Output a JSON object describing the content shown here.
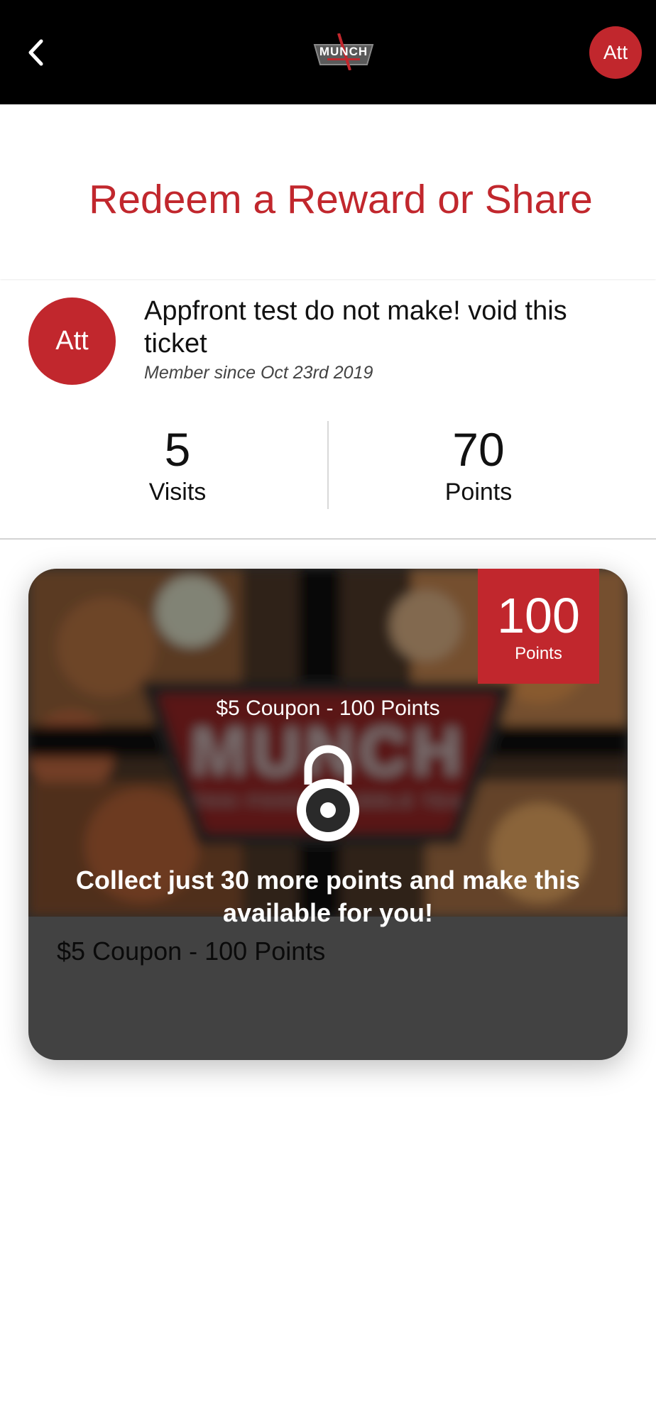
{
  "header": {
    "logo_text": "MUNCH",
    "avatar_initials": "Att"
  },
  "page": {
    "title": "Redeem a Reward or Share"
  },
  "profile": {
    "avatar_initials": "Att",
    "name": "Appfront test do not make! void this ticket",
    "member_since": "Member since Oct 23rd 2019",
    "stats": {
      "visits_value": "5",
      "visits_label": "Visits",
      "points_value": "70",
      "points_label": "Points"
    }
  },
  "reward": {
    "badge_value": "100",
    "badge_label": "Points",
    "overlay_title": "$5 Coupon - 100 Points",
    "unlock_message": "Collect just 30 more points and make this available for you!",
    "title": "$5 Coupon - 100 Points",
    "image_logo_text": "MUNCH",
    "image_logo_tagline": "THAI FOOD & BUBBLE TEA"
  },
  "colors": {
    "brand_red": "#c1272d",
    "topbar_bg": "#000000",
    "card_bg": "#424242"
  }
}
